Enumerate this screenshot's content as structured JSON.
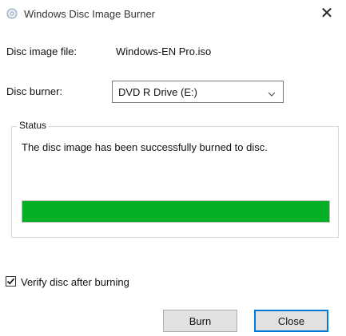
{
  "window": {
    "title": "Windows Disc Image Burner",
    "close_glyph": "✕"
  },
  "fields": {
    "disc_image_label": "Disc image file:",
    "disc_image_value": "Windows-EN Pro.iso",
    "burner_label": "Disc burner:",
    "burner_selected": "DVD R Drive (E:)"
  },
  "status": {
    "legend": "Status",
    "message": "The disc image has been successfully burned to disc.",
    "progress_fraction": 1.0,
    "progress_color": "#06b025"
  },
  "verify": {
    "label": "Verify disc after burning",
    "checked": true
  },
  "buttons": {
    "burn": "Burn",
    "close": "Close"
  },
  "icons": {
    "app": "disc-burner-icon",
    "close": "close-icon",
    "dropdown": "chevron-down-icon",
    "check": "checkmark-icon"
  }
}
